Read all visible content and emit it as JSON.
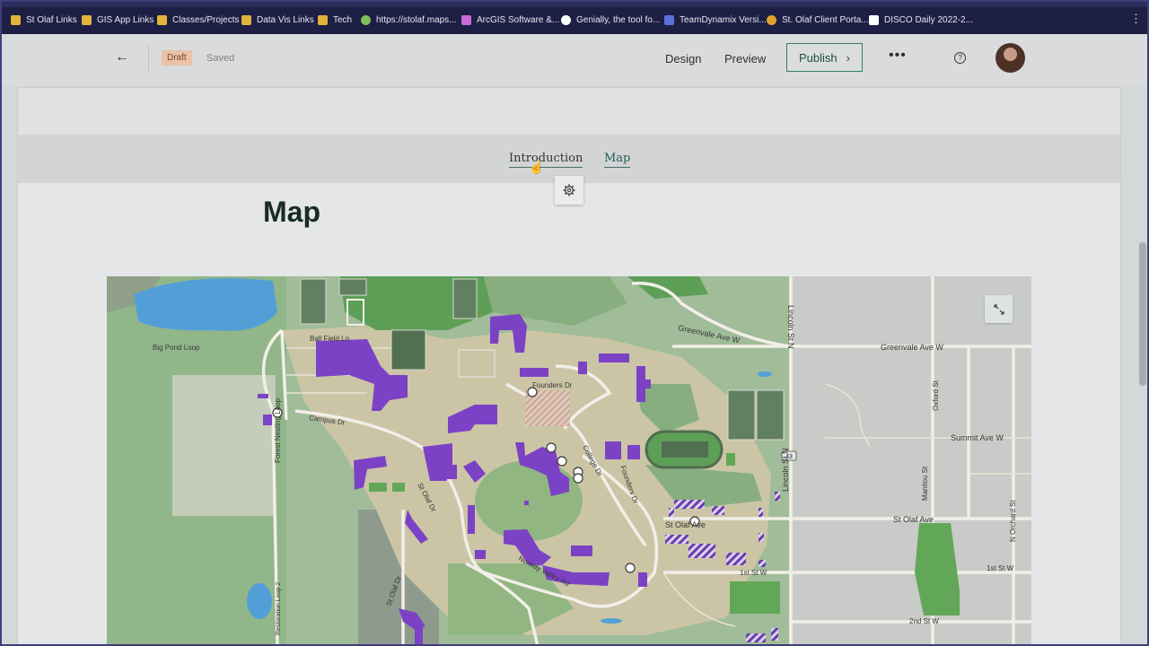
{
  "bookmarks": [
    {
      "label": "St Olaf Links",
      "icon": "folder-icon",
      "color": "#e2b33a"
    },
    {
      "label": "GIS App Links",
      "icon": "folder-icon",
      "color": "#e2b33a"
    },
    {
      "label": "Classes/Projects",
      "icon": "folder-icon",
      "color": "#e2b33a"
    },
    {
      "label": "Data Vis Links",
      "icon": "folder-icon",
      "color": "#e2b33a"
    },
    {
      "label": "Tech",
      "icon": "folder-icon",
      "color": "#e2b33a"
    },
    {
      "label": "https://stolaf.maps...",
      "icon": "globe-icon",
      "color": "#7fbf5a"
    },
    {
      "label": "ArcGIS Software &...",
      "icon": "arcgis-icon",
      "color": "#c86bd8"
    },
    {
      "label": "Genially, the tool fo...",
      "icon": "genially-icon",
      "color": "#ffffff"
    },
    {
      "label": "TeamDynamix Versi...",
      "icon": "teamdynamix-icon",
      "color": "#5b72d6"
    },
    {
      "label": "St. Olaf Client Porta...",
      "icon": "stolaf-icon",
      "color": "#e0a030"
    },
    {
      "label": "DISCO Daily 2022-2...",
      "icon": "trello-icon",
      "color": "#ffffff"
    }
  ],
  "header": {
    "back_label": "←",
    "status_badge": "Draft",
    "saved": "Saved",
    "design": "Design",
    "preview": "Preview",
    "publish": "Publish",
    "publish_chevron": "›",
    "more": "•••",
    "help": "?"
  },
  "story": {
    "nav": [
      "Introduction",
      "Map"
    ],
    "section_title": "Map"
  },
  "map_labels": {
    "big_pond_loop": "Big Pond Loop",
    "ball_field_ln": "Ball Field Ln",
    "campus_dr": "Campus Dr",
    "forest_nest_loop": "Forest Nesting Loop",
    "founders_dr": "Founders Dr",
    "college_dr": "College Dr",
    "founders_dr2": "Founders Dr",
    "st_olaf_dr": "St Olaf Dr",
    "st_olaf_dr2": "St Olaf Dr",
    "norway_valley_rd": "Norway Valley Rd",
    "greenvale1": "Greenvale Ave W",
    "greenvale2": "Greenvale Ave W",
    "lincoln_st_n": "Lincoln St N",
    "lincoln_st_s": "Lincoln St N",
    "oxford_st": "Oxford St",
    "summit_ave": "Summit Ave W",
    "manitou_st": "Manitou St",
    "st_olaf_ave1": "St Olaf Ave",
    "st_olaf_ave2": "St Olaf Ave",
    "first_st1": "1st St W",
    "first_st2": "1st St W",
    "n_orchard_st": "N Orchard St",
    "second_st": "2nd St W",
    "restoration_loop": "Restoration Loop 2",
    "route_43": "43"
  },
  "colors": {
    "building": "#7a3fc4",
    "park": "#5fa655",
    "campus_grass": "#94bd8c",
    "path_tan": "#cdc7a8",
    "water": "#4f9ed8",
    "brand_green": "#2f7d6b"
  }
}
